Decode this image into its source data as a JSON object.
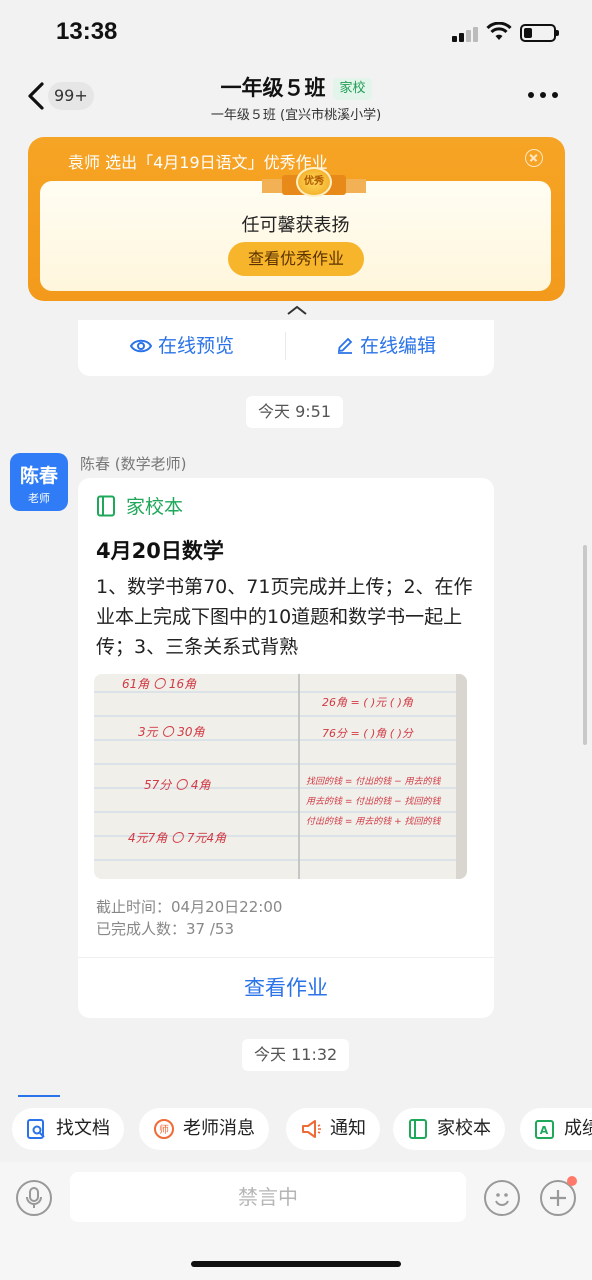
{
  "status_bar": {
    "time": "13:38",
    "battery_level": 0.3
  },
  "nav": {
    "unread_count": "99+",
    "title": "一年级５班",
    "title_tag": "家校",
    "subtitle": "一年级５班 (宜兴市桃溪小学)"
  },
  "banner": {
    "headline": "袁师 选出「4月19日语文」优秀作业",
    "medal_label": "优秀",
    "message": "任可馨获表扬",
    "button": "查看优秀作业"
  },
  "prev_card": {
    "preview": "在线预览",
    "edit": "在线编辑"
  },
  "timestamps": {
    "first": "今天 9:51",
    "second": "今天 11:32"
  },
  "message": {
    "avatar_name": "陈春",
    "avatar_role": "老师",
    "sender": "陈春 (数学老师)",
    "tag": "家校本",
    "title": "4月20日数学",
    "body": "1、数学书第70、71页完成并上传；2、在作业本上完成下图中的10道题和数学书一起上传；3、三条关系式背熟",
    "deadline": "截止时间：04月20日22:00",
    "completed": "已完成人数：37 /53",
    "action": "查看作业"
  },
  "homework_image": {
    "left_lines": [
      "61角 〇 16角",
      "3元 〇 30角",
      "57分 〇 4角",
      "4元7角 〇 7元4角"
    ],
    "right_lines": [
      "26角 = (   )元 (   )角",
      "76分 = (   )角 (   )分",
      "找回的钱 = 付出的钱 − 用去的钱",
      "用去的钱 = 付出的钱 − 找回的钱",
      "付出的钱 = 用去的钱 + 找回的钱"
    ]
  },
  "shortcuts": [
    {
      "label": "找文档",
      "icon": "document-search-icon",
      "color": "#2a73e8"
    },
    {
      "label": "老师消息",
      "icon": "teacher-message-icon",
      "color": "#f06a35"
    },
    {
      "label": "通知",
      "icon": "megaphone-icon",
      "color": "#f06a35"
    },
    {
      "label": "家校本",
      "icon": "notebook-icon",
      "color": "#1fa85a"
    },
    {
      "label": "成绩",
      "icon": "grade-icon",
      "color": "#1fa85a"
    }
  ],
  "input": {
    "placeholder": "禁言中"
  },
  "colors": {
    "accent_blue": "#2a73e8",
    "banner_orange": "#f39a1c",
    "tag_green": "#1fa85a"
  }
}
